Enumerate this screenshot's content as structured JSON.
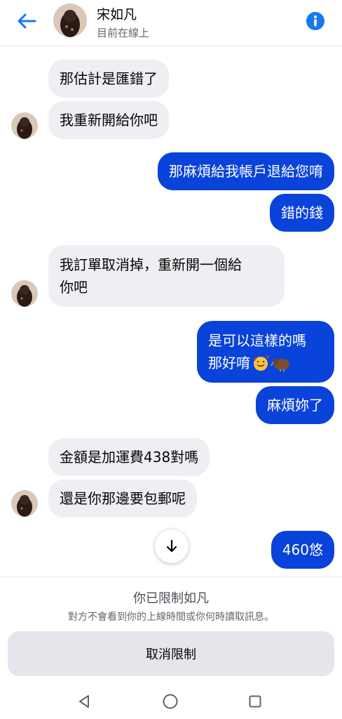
{
  "header": {
    "contact_name": "宋如凡",
    "status": "目前在線上",
    "back_icon": "arrow-left-icon",
    "info_icon": "info-icon"
  },
  "messages": [
    {
      "side": "in",
      "text": "那估計是匯錯了"
    },
    {
      "side": "in",
      "text": "我重新開給你吧"
    },
    {
      "side": "out",
      "text": "那麻煩給我帳戶退給您唷"
    },
    {
      "side": "out",
      "text": "錯的錢"
    },
    {
      "side": "in",
      "lines": [
        "我訂單取消掉，重新開一個給",
        "你吧"
      ]
    },
    {
      "side": "out",
      "lines": [
        "是可以這樣的嗎",
        "那好唷"
      ],
      "emoji": [
        "smiling-face-with-hearts-emoji",
        "kiwi-bird-emoji"
      ]
    },
    {
      "side": "out",
      "text": "麻煩妳了"
    },
    {
      "side": "in",
      "text": "金額是加運費438對嗎"
    },
    {
      "side": "in",
      "text": "還是你那邊要包郵呢"
    },
    {
      "side": "out",
      "text": "460悠"
    }
  ],
  "restriction": {
    "title": "你已限制如凡",
    "description": "對方不會看到你的上線時間或你何時讀取訊息。",
    "button_label": "取消限制"
  },
  "colors": {
    "accent": "#0a43d9",
    "incoming_bubble": "#eeeff2",
    "header_icon": "#1877f2"
  },
  "navbar": {
    "icons": [
      "back-triangle-icon",
      "home-circle-icon",
      "recents-square-icon"
    ]
  }
}
